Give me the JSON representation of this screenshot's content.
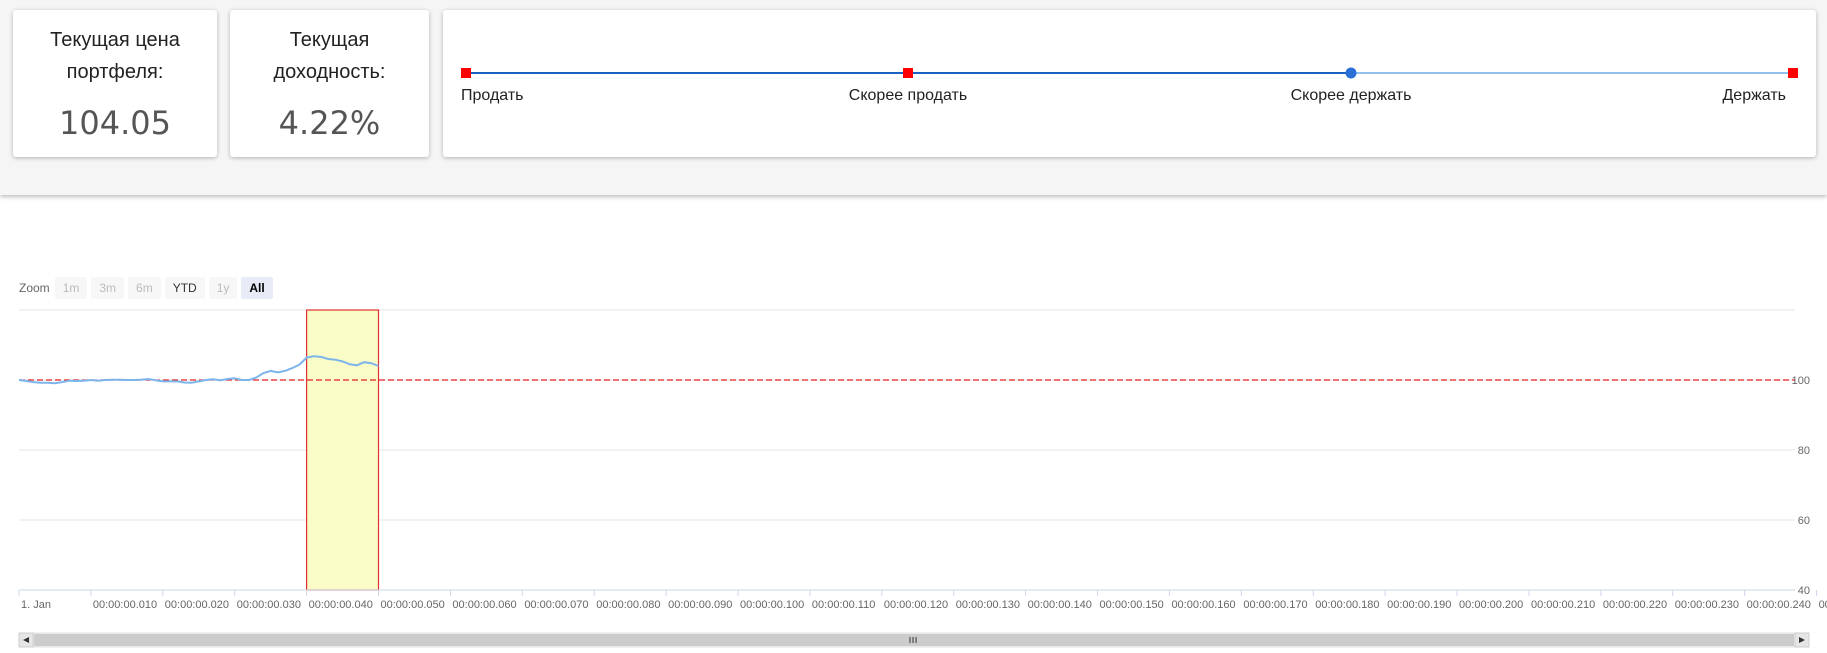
{
  "cards": {
    "price": {
      "label_line1": "Текущая цена",
      "label_line2": "портфеля:",
      "value": "104.05"
    },
    "yield": {
      "label_line1": "Текущая",
      "label_line2": "доходность:",
      "value": "4.22%"
    }
  },
  "signal": {
    "stops": [
      "Продать",
      "Скорее продать",
      "Скорее держать",
      "Держать"
    ],
    "current_index": 2,
    "colors": {
      "marker": "#ff0000",
      "current": "#2a6fd6",
      "track": "#1a5fc4",
      "track_light": "#90bff0"
    }
  },
  "chart": {
    "zoom_label": "Zoom",
    "zoom_buttons": [
      {
        "label": "1m",
        "state": "disabled"
      },
      {
        "label": "3m",
        "state": "disabled"
      },
      {
        "label": "6m",
        "state": "disabled"
      },
      {
        "label": "YTD",
        "state": "enabled"
      },
      {
        "label": "1y",
        "state": "disabled"
      },
      {
        "label": "All",
        "state": "active"
      }
    ]
  },
  "chart_data": {
    "type": "line",
    "ylim": [
      40,
      120
    ],
    "y_ticks": [
      "100",
      "80",
      "60",
      "40"
    ],
    "x_ticks": [
      "1. Jan",
      "00:00:00.010",
      "00:00:00.020",
      "00:00:00.030",
      "00:00:00.040",
      "00:00:00.050",
      "00:00:00.060",
      "00:00:00.070",
      "00:00:00.080",
      "00:00:00.090",
      "00:00:00.100",
      "00:00:00.110",
      "00:00:00.120",
      "00:00:00.130",
      "00:00:00.140",
      "00:00:00.150",
      "00:00:00.160",
      "00:00:00.170",
      "00:00:00.180",
      "00:00:00.190",
      "00:00:00.200",
      "00:00:00.210",
      "00:00:00.220",
      "00:00:00.230",
      "00:00:00.240",
      "00:0..."
    ],
    "x_step_ms": 1,
    "x_range_ms": [
      0,
      247
    ],
    "reference_line": {
      "value": 100,
      "color": "#e02020",
      "style": "dashed"
    },
    "highlight_band": {
      "x_from_ms": 40,
      "x_to_ms": 50,
      "fill": "#fafcc8",
      "border": "#e03030"
    },
    "series": [
      {
        "color": "#7cb5ec",
        "values": [
          100.0,
          99.7,
          99.4,
          99.2,
          99.2,
          99.1,
          99.4,
          99.8,
          99.7,
          99.8,
          100.0,
          99.8,
          100.0,
          100.1,
          100.1,
          100.0,
          100.0,
          100.1,
          100.3,
          99.9,
          99.6,
          99.6,
          99.6,
          99.3,
          99.2,
          99.6,
          100.0,
          100.2,
          99.9,
          100.3,
          100.5,
          100.0,
          100.0,
          100.7,
          102.0,
          102.6,
          102.2,
          102.6,
          103.4,
          104.4,
          106.4,
          106.8,
          106.6,
          106.0,
          105.8,
          105.3,
          104.5,
          104.2,
          105.1,
          104.8,
          104.0
        ]
      }
    ]
  }
}
